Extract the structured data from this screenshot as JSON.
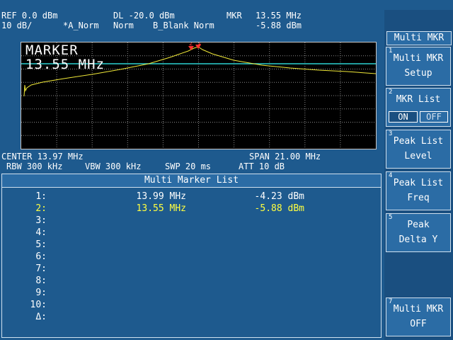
{
  "header": {
    "ref": "REF 0.0 dBm",
    "scale": "10 dB/",
    "a_trace": "*A_Norm",
    "norm1": "Norm",
    "dl": "DL -20.0 dBm",
    "b_trace": "B_Blank Norm",
    "mkr_label": "MKR",
    "mkr_freq": "13.55 MHz",
    "mkr_level": "-5.88 dBm"
  },
  "display": {
    "marker_title": "MARKER",
    "marker_value": "13.55 MHz",
    "marker_ids": "2 1",
    "colors": {
      "trace": "#f0e838",
      "display_line": "#2ad0d0",
      "marker": "#ff3030",
      "grid": "#8a8a8a"
    }
  },
  "footer": {
    "center": "CENTER 13.97 MHz",
    "span": "SPAN 21.00 MHz",
    "rbw": "RBW 300 kHz",
    "vbw": "VBW 300 kHz",
    "swp": "SWP 20 ms",
    "att": "ATT 10 dB"
  },
  "marker_list": {
    "title": "Multi Marker List",
    "rows": [
      {
        "idx": "1:",
        "freq": "13.99 MHz",
        "level": "-4.23 dBm",
        "active": false
      },
      {
        "idx": "2:",
        "freq": "13.55 MHz",
        "level": "-5.88 dBm",
        "active": true
      },
      {
        "idx": "3:",
        "freq": "",
        "level": "",
        "active": false
      },
      {
        "idx": "4:",
        "freq": "",
        "level": "",
        "active": false
      },
      {
        "idx": "5:",
        "freq": "",
        "level": "",
        "active": false
      },
      {
        "idx": "6:",
        "freq": "",
        "level": "",
        "active": false
      },
      {
        "idx": "7:",
        "freq": "",
        "level": "",
        "active": false
      },
      {
        "idx": "8:",
        "freq": "",
        "level": "",
        "active": false
      },
      {
        "idx": "9:",
        "freq": "",
        "level": "",
        "active": false
      },
      {
        "idx": "10:",
        "freq": "",
        "level": "",
        "active": false
      },
      {
        "idx": "Δ:",
        "freq": "",
        "level": "",
        "active": false
      }
    ]
  },
  "softkeys": {
    "title": "Multi MKR",
    "keys": [
      {
        "num": "1",
        "line1": "Multi MKR",
        "line2": "Setup"
      },
      {
        "num": "2",
        "line1": "MKR List",
        "on": "ON",
        "off": "OFF"
      },
      {
        "num": "3",
        "line1": "Peak List",
        "line2": "Level"
      },
      {
        "num": "4",
        "line1": "Peak List",
        "line2": "Freq"
      },
      {
        "num": "5",
        "line1": "Peak",
        "line2": "Delta Y"
      },
      {
        "num": "7",
        "line1": "Multi MKR",
        "line2": "OFF"
      }
    ]
  }
}
